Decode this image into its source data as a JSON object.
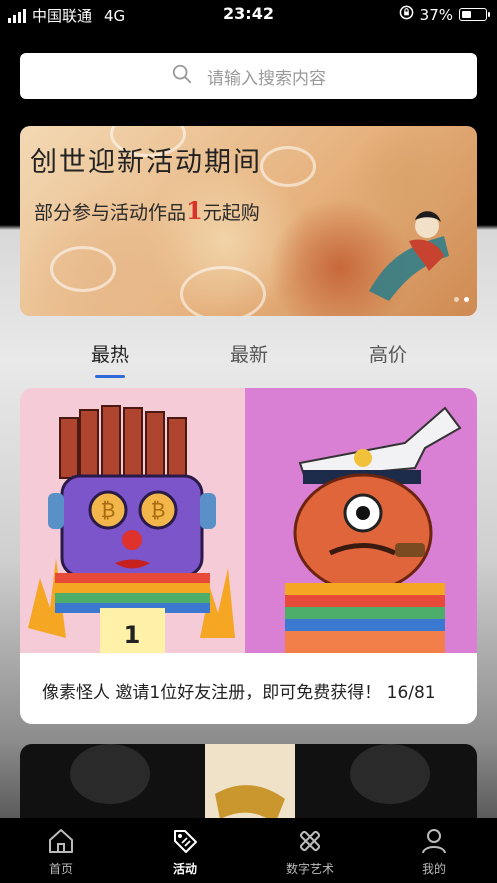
{
  "status_bar": {
    "carrier": "中国联通",
    "network": "4G",
    "time": "23:42",
    "battery": "37%",
    "icons": [
      "signal-icon",
      "orientation-lock-icon",
      "battery-icon"
    ]
  },
  "search": {
    "placeholder": "请输入搜索内容",
    "icon": "search-icon"
  },
  "banner": {
    "title": "创世迎新活动期间",
    "subtitle_pre": "部分参与活动作品",
    "subtitle_highlight": "1",
    "subtitle_post": "元起购"
  },
  "tabs": [
    {
      "label": "最热",
      "active": true
    },
    {
      "label": "最新",
      "active": false
    },
    {
      "label": "高价",
      "active": false
    }
  ],
  "card": {
    "caption": "像素怪人 邀请1位好友注册，即可免费获得！ 16/81"
  },
  "tabbar": [
    {
      "label": "首页",
      "icon": "home-icon",
      "active": false
    },
    {
      "label": "活动",
      "icon": "tag-icon",
      "active": true
    },
    {
      "label": "数字艺术",
      "icon": "art-tools-icon",
      "active": false
    },
    {
      "label": "我的",
      "icon": "user-icon",
      "active": false
    }
  ],
  "colors": {
    "accent": "#2f6bd8",
    "highlight": "#d9342b"
  }
}
